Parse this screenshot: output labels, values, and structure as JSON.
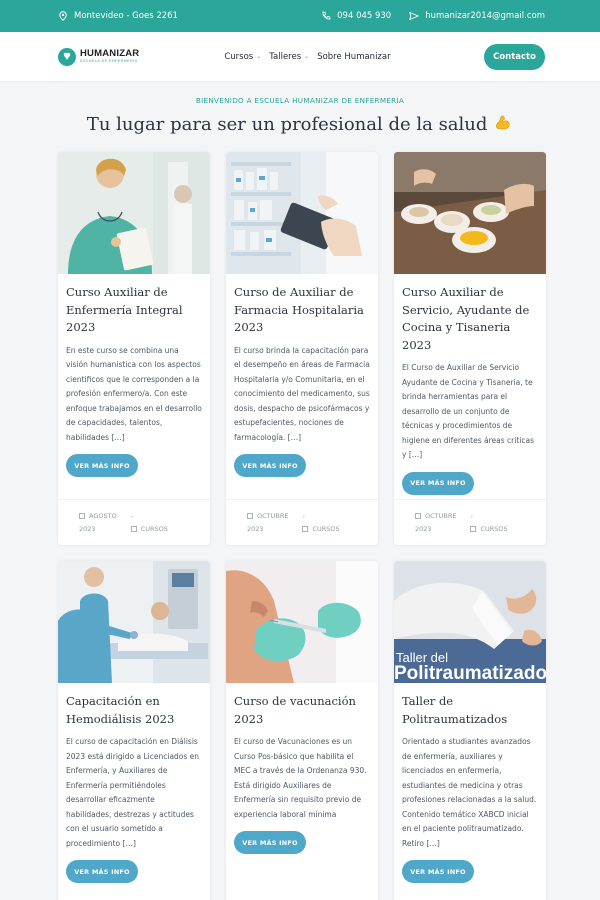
{
  "topbar": {
    "location": "Montevideo - Goes 2261",
    "phone": "094 045 930",
    "email": "humanizar2014@gmail.com"
  },
  "nav": {
    "logo_name": "HUMANIZAR",
    "logo_sub": "ESCUELA DE ENFERMERÍA",
    "items": [
      "Cursos",
      "Talleres",
      "Sobre Humanizar"
    ],
    "contact": "Contacto"
  },
  "hero": {
    "eyebrow": "BIENVENIDO A ESCUELA HUMANIZAR DE ENFERMERÍA",
    "headline": "Tu lugar para ser un profesional de la salud"
  },
  "colors": {
    "primary": "#2aa69a",
    "button": "#4fa8c9"
  },
  "cards": [
    {
      "title": "Curso Auxiliar de Enfermería Integral 2023",
      "text": "En este curso se combina una visión humanistica con los aspectos cientificos que le corresponden a la profesión enfermero/a. Con este enfoque trabajamos en el desarrollo de capacidades, talentos, habilidades […]",
      "button": "VER MÁS INFO",
      "date_month": "AGOSTO",
      "date_sep": "-",
      "date_year": "2023",
      "category": "CURSOS"
    },
    {
      "title": "Curso de Auxiliar de Farmacia Hospitalaria 2023",
      "text": "El curso brinda la capacitación para el desempeño en áreas de Farmacia Hospitalaria y/o Comunitaria, en el conocimiento del medicamento, sus dosis, despacho de psicofármacos y estupefacientes, nociones de farmacología. […]",
      "button": "VER MÁS INFO",
      "date_month": "OCTUBRE",
      "date_sep": "-",
      "date_year": "2023",
      "category": "CURSOS"
    },
    {
      "title": "Curso Auxiliar de Servicio, Ayudante de Cocina y Tisaneria 2023",
      "text": "El Curso de Auxiliar de Servicio Ayudante de Cocina y Tisaneria, te brinda herramientas para el desarrollo de un conjunto de técnicas y procedimientos de higiene en diferentes áreas criticas y […]",
      "button": "VER MÁS INFO",
      "date_month": "OCTUBRE",
      "date_sep": "-",
      "date_year": "2023",
      "category": "CURSOS"
    },
    {
      "title": "Capacitación en Hemodiálisis 2023",
      "text": "El curso de capacitación en Diálisis 2023 está dirigido a Licenciados en Enfermería, y Auxiliares de Enfermería permitiéndoles desarrollar eficazmente habilidades, destrezas y actitudes con el usuario sometido a procedimiento […]",
      "button": "VER MÁS INFO"
    },
    {
      "title": "Curso de vacunación 2023",
      "text": "El curso de Vacunaciones es un Curso Pos-básico que habilita el MEC a través de la Ordenanza 930. Está dirigido Auxiliares de Enfermería sin requisito previo de experiencia laboral mínima",
      "button": "VER MÁS INFO"
    },
    {
      "title": "Taller de Politraumatizados",
      "text": "Orientado a studiantes avanzados de enfermería, auxiliares y licenciados en enfermeria, estudiantes de medicina y otras profesiones relacionadas a la salud. Contenido temático XABCD inicial en el paciente politraumatizado. Retiro […]",
      "button": "VER MÁS INFO",
      "banner": "Taller del Politraumatizado"
    }
  ]
}
